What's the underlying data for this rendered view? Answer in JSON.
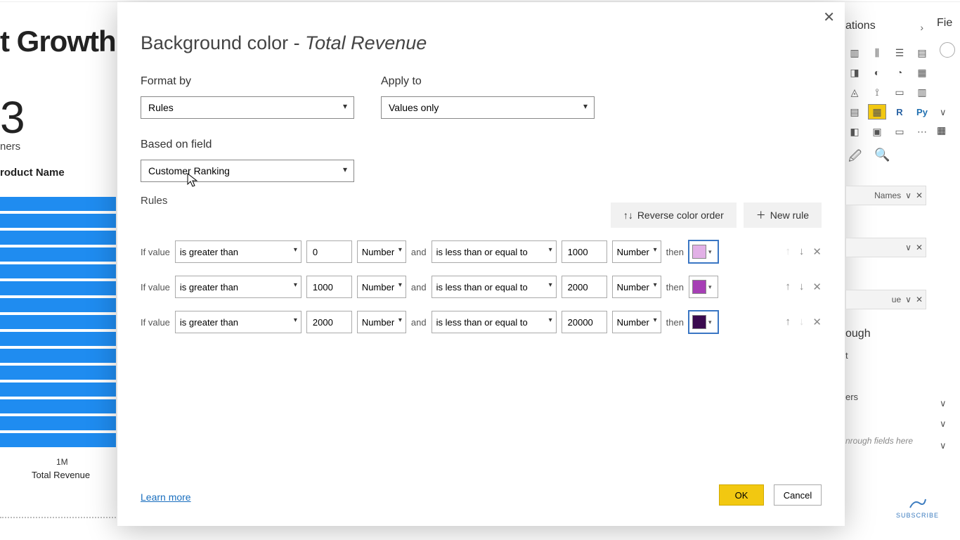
{
  "behind": {
    "title_fragment": "t Growth",
    "big_number": "3",
    "big_label": "ners",
    "y_axis_label": "roduct Name",
    "x_tick": "1M",
    "x_title": "Total Revenue"
  },
  "dialog": {
    "title_prefix": "Background color - ",
    "title_field": "Total Revenue",
    "format_by_label": "Format by",
    "format_by_value": "Rules",
    "apply_to_label": "Apply to",
    "apply_to_value": "Values only",
    "based_on_label": "Based on field",
    "based_on_value": "Customer Ranking",
    "rules_label": "Rules",
    "reverse_label": "Reverse color order",
    "new_rule_label": "New rule",
    "if_value": "If value",
    "and": "and",
    "then": "then",
    "op_gt": "is greater than",
    "op_lte": "is less than or equal to",
    "type_number": "Number",
    "rules": [
      {
        "min": "0",
        "max": "1000",
        "color": "#e2b0e6"
      },
      {
        "min": "1000",
        "max": "2000",
        "color": "#a63fb5"
      },
      {
        "min": "2000",
        "max": "20000",
        "color": "#3a0a4f"
      }
    ],
    "learn_more": "Learn more",
    "ok": "OK",
    "cancel": "Cancel"
  },
  "right": {
    "viz_header": "ations",
    "fields_header": "Fie",
    "slot_names": "Names",
    "slot_revenue": "ue",
    "drill_header": "ough",
    "drill_sub": "t",
    "tooltip_item": "ers",
    "drag_hint": "nrough fields here",
    "R": "R",
    "Py": "Py"
  },
  "subscribe": "SUBSCRIBE"
}
